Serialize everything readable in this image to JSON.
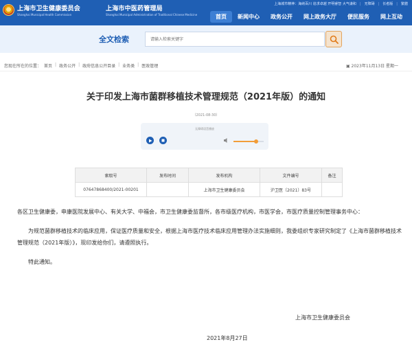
{
  "header": {
    "org_name": "上海市卫生健康委员会",
    "org_name_en": "Shanghai Municipal Health Commission",
    "org2_name": "上海市中医药管理局",
    "org2_name_en": "Shanghai Municipal Administration of Traditional Chinese Medicine",
    "topbar": {
      "spirit": "上海城市精神：海纳百川 追求卓越 开明睿智 大气谦和",
      "accessibility": "无障碍",
      "elderly": "长者版",
      "traditional": "繁體"
    },
    "nav": [
      "首页",
      "新闻中心",
      "政务公开",
      "网上政务大厅",
      "便民服务",
      "网上互动"
    ],
    "active_nav_index": 0
  },
  "search": {
    "title": "全文检索",
    "placeholder": "请输入检索关键字"
  },
  "breadcrumb": {
    "prefix": "您现在所在的位置：",
    "items": [
      "首页",
      "政务公开",
      "政府信息公开目录",
      "业务类",
      "医政管理"
    ],
    "date": "2023年11月13日 星期一"
  },
  "article": {
    "title": "关于印发上海市菌群移植技术管理规范（2021年版）的通知",
    "pub_date": "（2021-08-30）",
    "player_label": "无障碍语音播放",
    "volume_level": 0.75
  },
  "meta_table": {
    "headers": [
      "索取号",
      "发布时间",
      "发布机构",
      "文件编号",
      "备注"
    ],
    "values": [
      "07647868400/2021-00201",
      "",
      "上海市卫生健康委员会",
      "沪卫医〔2021〕83号",
      ""
    ]
  },
  "body": {
    "recipients": "各区卫生健康委，申康医院发展中心、有关大学、中福会，市卫生健康委监督所，各市级医疗机构，市医学会，市医疗质量控制管理事务中心：",
    "paragraph": "为规范菌群移植技术的临床应用，保证医疗质量和安全，根据上海市医疗技术临床应用管理办法实施细则，我委组织专家研究制定了《上海市菌群移植技术管理规范（2021年版）》，现印发给你们，请遵照执行。",
    "closing": "特此通知。",
    "signature": "上海市卫生健康委员会",
    "sign_date": "2021年8月27日"
  },
  "colors": {
    "header_bg": "#1f5fb4",
    "search_band": "#eaf2fc",
    "accent_orange": "#f29d38"
  }
}
